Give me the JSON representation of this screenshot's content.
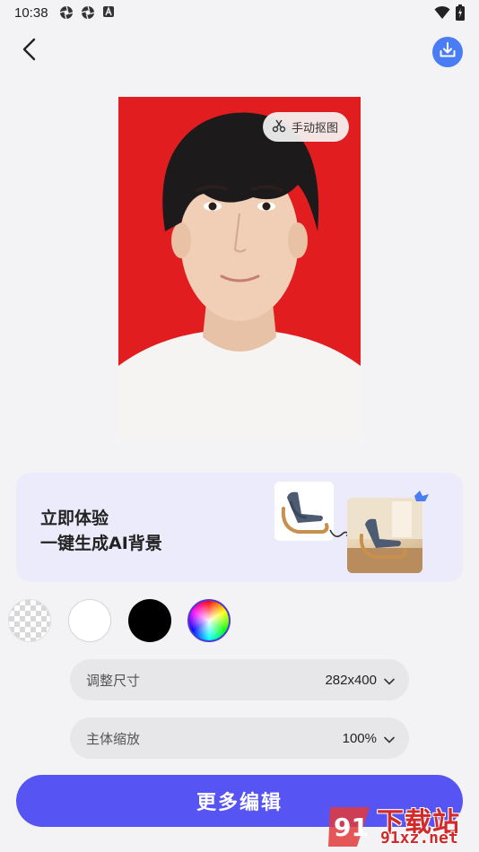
{
  "status_bar": {
    "time": "10:38",
    "left_icons": [
      "aperture-icon",
      "aperture-icon",
      "a-badge-icon"
    ],
    "right_icons": [
      "wifi-icon",
      "battery-charging-icon"
    ]
  },
  "nav": {
    "back_icon": "chevron-left-icon",
    "download_icon": "download-icon",
    "accent": "#4a7df4"
  },
  "photo": {
    "background_color": "#e21d1f",
    "manual_cutout_label": "手动抠图",
    "manual_cutout_icon": "scissors-icon"
  },
  "ai_banner": {
    "line1": "立即体验",
    "line2": "一键生成AI背景",
    "background": "#ecebfb"
  },
  "swatches": [
    {
      "name": "transparent",
      "color": "transparent",
      "selected": false
    },
    {
      "name": "white",
      "color": "#ffffff",
      "selected": false
    },
    {
      "name": "black",
      "color": "#000000",
      "selected": false
    },
    {
      "name": "custom",
      "color": "rainbow",
      "selected": true
    }
  ],
  "options": {
    "size_label": "调整尺寸",
    "size_value": "282x400",
    "scale_label": "主体缩放",
    "scale_value": "100%"
  },
  "actions": {
    "more_edit_label": "更多编辑",
    "color": "#5654f2"
  },
  "watermark": {
    "title": "下载站",
    "url": "91xz.net",
    "logo_text": "91",
    "color": "#d22a2a"
  }
}
